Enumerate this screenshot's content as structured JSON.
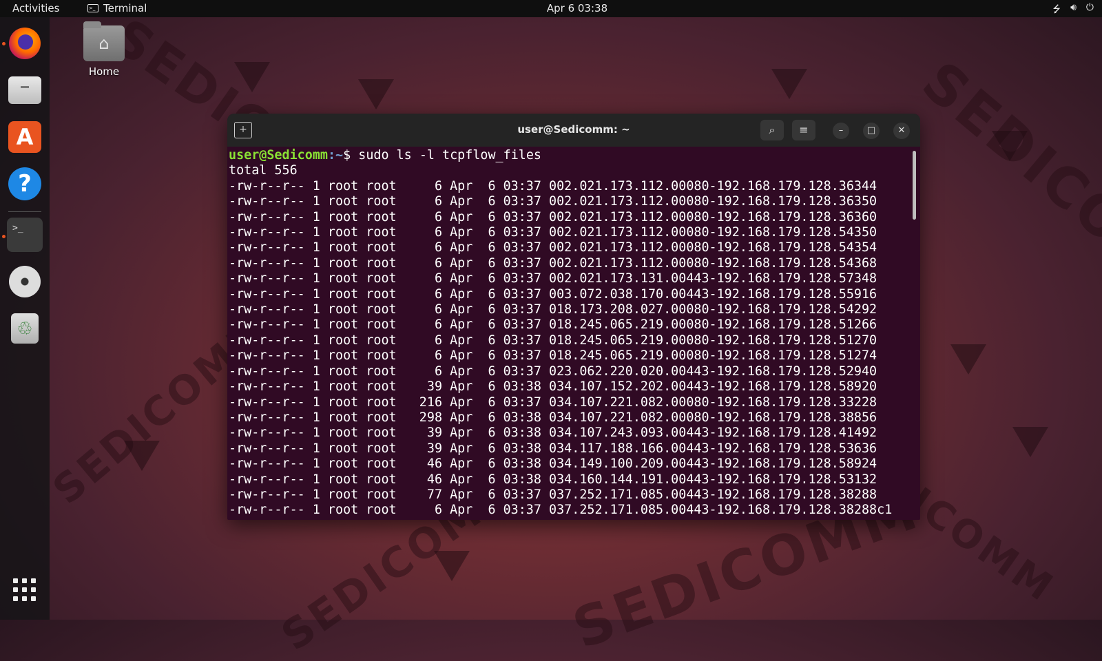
{
  "topbar": {
    "activities": "Activities",
    "app_name": "Terminal",
    "clock": "Apr 6  03:38"
  },
  "desktop": {
    "home_label": "Home"
  },
  "dock": {
    "items": [
      "firefox-icon",
      "files-icon",
      "software-icon",
      "help-icon",
      "terminal-icon",
      "dvd-icon",
      "trash-icon",
      "app-grid-icon"
    ]
  },
  "window": {
    "title": "user@Sedicomm: ~",
    "prompt_user": "user@Sedicomm",
    "prompt_path": ":~",
    "prompt_symbol": "$ ",
    "command": "sudo ls -l tcpflow_files",
    "total": "total 556",
    "lines": [
      "-rw-r--r-- 1 root root     6 Apr  6 03:37 002.021.173.112.00080-192.168.179.128.36344",
      "-rw-r--r-- 1 root root     6 Apr  6 03:37 002.021.173.112.00080-192.168.179.128.36350",
      "-rw-r--r-- 1 root root     6 Apr  6 03:37 002.021.173.112.00080-192.168.179.128.36360",
      "-rw-r--r-- 1 root root     6 Apr  6 03:37 002.021.173.112.00080-192.168.179.128.54350",
      "-rw-r--r-- 1 root root     6 Apr  6 03:37 002.021.173.112.00080-192.168.179.128.54354",
      "-rw-r--r-- 1 root root     6 Apr  6 03:37 002.021.173.112.00080-192.168.179.128.54368",
      "-rw-r--r-- 1 root root     6 Apr  6 03:37 002.021.173.131.00443-192.168.179.128.57348",
      "-rw-r--r-- 1 root root     6 Apr  6 03:37 003.072.038.170.00443-192.168.179.128.55916",
      "-rw-r--r-- 1 root root     6 Apr  6 03:37 018.173.208.027.00080-192.168.179.128.54292",
      "-rw-r--r-- 1 root root     6 Apr  6 03:37 018.245.065.219.00080-192.168.179.128.51266",
      "-rw-r--r-- 1 root root     6 Apr  6 03:37 018.245.065.219.00080-192.168.179.128.51270",
      "-rw-r--r-- 1 root root     6 Apr  6 03:37 018.245.065.219.00080-192.168.179.128.51274",
      "-rw-r--r-- 1 root root     6 Apr  6 03:37 023.062.220.020.00443-192.168.179.128.52940",
      "-rw-r--r-- 1 root root    39 Apr  6 03:38 034.107.152.202.00443-192.168.179.128.58920",
      "-rw-r--r-- 1 root root   216 Apr  6 03:37 034.107.221.082.00080-192.168.179.128.33228",
      "-rw-r--r-- 1 root root   298 Apr  6 03:38 034.107.221.082.00080-192.168.179.128.38856",
      "-rw-r--r-- 1 root root    39 Apr  6 03:38 034.107.243.093.00443-192.168.179.128.41492",
      "-rw-r--r-- 1 root root    39 Apr  6 03:38 034.117.188.166.00443-192.168.179.128.53636",
      "-rw-r--r-- 1 root root    46 Apr  6 03:38 034.149.100.209.00443-192.168.179.128.58924",
      "-rw-r--r-- 1 root root    46 Apr  6 03:38 034.160.144.191.00443-192.168.179.128.53132",
      "-rw-r--r-- 1 root root    77 Apr  6 03:37 037.252.171.085.00443-192.168.179.128.38288",
      "-rw-r--r-- 1 root root     6 Apr  6 03:37 037.252.171.085.00443-192.168.179.128.38288c1"
    ]
  },
  "wallpaper": {
    "watermark": "SEDICOMM"
  },
  "colors": {
    "terminal_bg": "#300a24",
    "prompt_user": "#8ae234",
    "prompt_path": "#729fcf",
    "accent": "#e95420"
  }
}
